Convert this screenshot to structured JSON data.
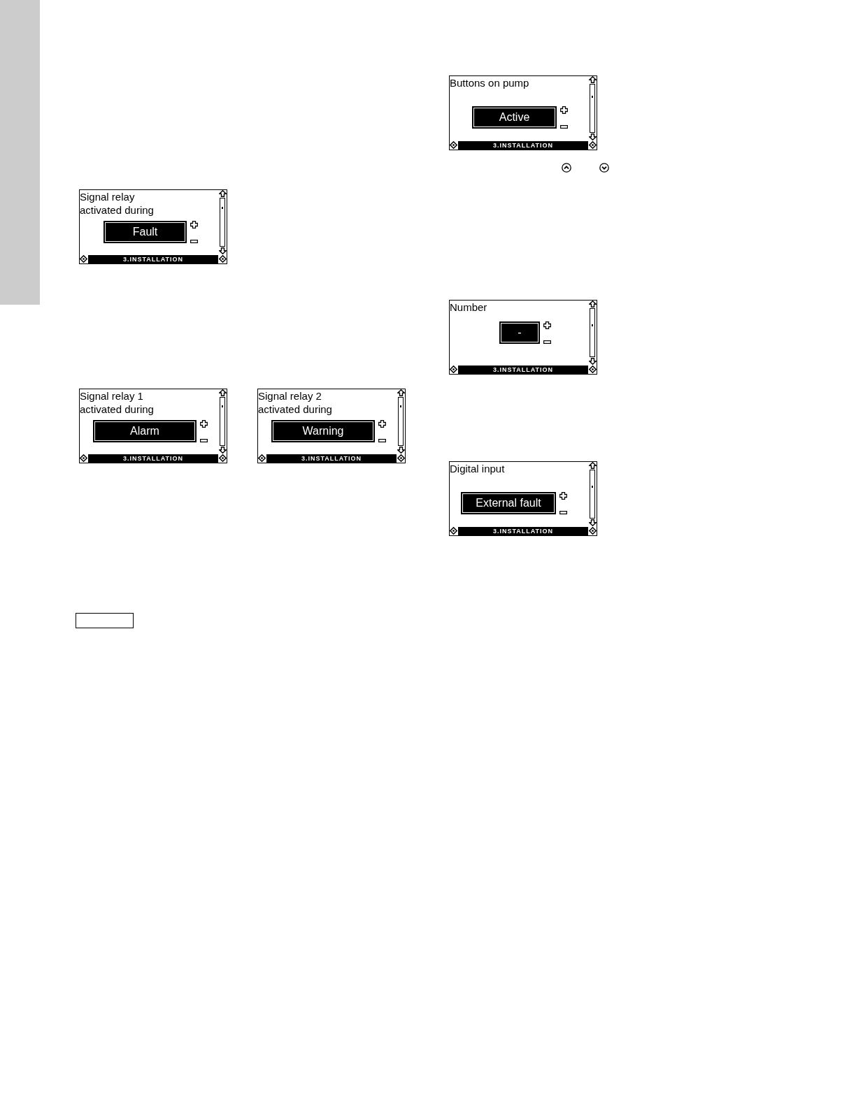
{
  "left_column": {
    "screens": [
      {
        "title": "Signal relay activated during",
        "value": "Fault",
        "footer": "3.INSTALLATION"
      },
      {
        "title": "Signal relay 1 activated during",
        "value": "Alarm",
        "footer": "3.INSTALLATION"
      },
      {
        "title": "Signal relay 2 activated during",
        "value": "Warning",
        "footer": "3.INSTALLATION"
      }
    ]
  },
  "right_column": {
    "screens": [
      {
        "title": "Buttons on pump",
        "value": "Active",
        "footer": "3.INSTALLATION"
      },
      {
        "title": "Number",
        "value": "-",
        "footer": "3.INSTALLATION"
      },
      {
        "title": "Digital input",
        "value": "External fault",
        "footer": "3.INSTALLATION"
      }
    ]
  }
}
